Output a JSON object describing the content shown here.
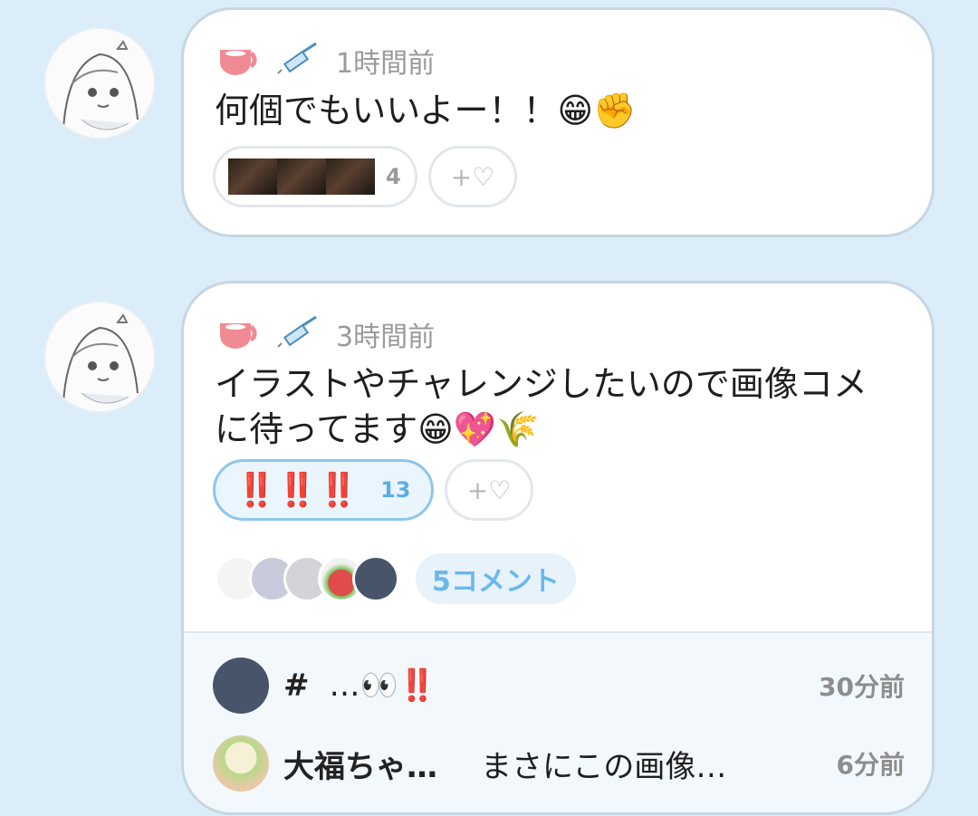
{
  "posts": [
    {
      "time": "1時間前",
      "text_lines": [
        "何個でもいいよー！！😁✊"
      ],
      "reactions": [
        {
          "type": "image-thumbnails",
          "count": "4"
        }
      ],
      "add_reaction": "+♡"
    },
    {
      "time": "3時間前",
      "text_lines": [
        "イラストやチャレンジしたいので画像コメ",
        "に待ってます😁💖🌾"
      ],
      "reactions": [
        {
          "type": "emoji",
          "emoji": "‼️ ‼️ ‼️",
          "count": "13",
          "active": true
        }
      ],
      "add_reaction": "+♡",
      "comment_link": "5コメント",
      "comments": [
        {
          "name": "#",
          "text": "…👀‼️",
          "time": "30分前"
        },
        {
          "name": "大福ちゃ…",
          "text": "まさにこの画像…",
          "time": "6分前"
        }
      ]
    }
  ],
  "colors": {
    "background": "#dcedfa",
    "accent": "#5aaee4",
    "alert": "#e33333"
  }
}
